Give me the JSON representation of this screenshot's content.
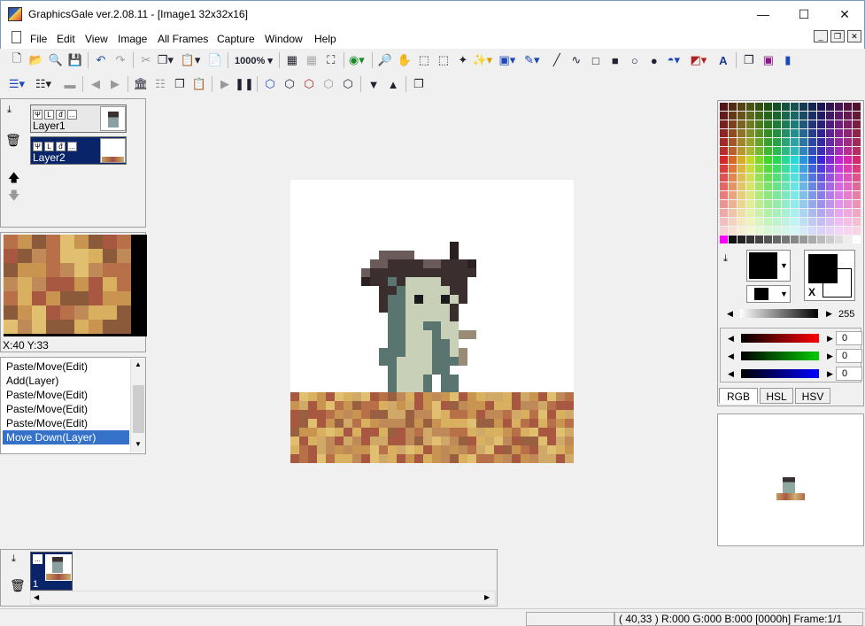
{
  "window": {
    "title": "GraphicsGale ver.2.08.11 - [Image1 32x32x16]",
    "minimize_glyph": "—",
    "maximize_glyph": "☐",
    "close_glyph": "✕"
  },
  "menu": [
    "File",
    "Edit",
    "View",
    "Image",
    "All Frames",
    "Capture",
    "Window",
    "Help"
  ],
  "mdi_controls": [
    "_",
    "❐",
    "✕"
  ],
  "toolbar": {
    "zoom_label": "1000%",
    "icons_row1": [
      "new-icon",
      "open-icon",
      "zoom-find-icon",
      "save-icon",
      "undo-icon",
      "redo-icon",
      "cut-icon",
      "copy-icon",
      "paste-icon",
      "paste-new-icon",
      "grid-icon",
      "pixel-grid-icon",
      "fit-icon",
      "color-replace-icon",
      "magnifier-icon",
      "hand-icon",
      "rect-select-icon",
      "lasso-icon",
      "polygon-select-icon",
      "magic-wand-icon",
      "brush-select-icon",
      "pen-icon",
      "line-icon",
      "curve-icon",
      "rect-outline-icon",
      "rect-fill-icon",
      "ellipse-outline-icon",
      "ellipse-fill-icon",
      "fill-bucket-icon",
      "gradient-icon",
      "text-icon",
      "transparent-icon",
      "frame-icon",
      "dropper-icon"
    ],
    "icons_row2": [
      "layer-menu-icon",
      "frame-menu-icon",
      "lock-icon",
      "prev-frame-icon",
      "next-frame-icon",
      "layer-props-icon",
      "all-frames-icon",
      "copy-frame-icon",
      "paste-frame-icon",
      "play-icon",
      "pause-icon",
      "add-layer-icon",
      "delete-layer-icon",
      "erase-layer-icon",
      "merge-layer-icon",
      "down-icon",
      "up-icon",
      "export-icon"
    ]
  },
  "layers": {
    "items": [
      {
        "name": "Layer1",
        "selected": false
      },
      {
        "name": "Layer2",
        "selected": true
      }
    ],
    "layer_buttons": [
      "Ψ",
      "L",
      "đ",
      "..."
    ]
  },
  "preview_panel": {
    "coords": "X:40 Y:33"
  },
  "history": {
    "items": [
      "Paste/Move(Edit)",
      "Add(Layer)",
      "Paste/Move(Edit)",
      "Paste/Move(Edit)",
      "Paste/Move(Edit)",
      "Move Down(Layer)"
    ],
    "selected_index": 5
  },
  "palette": {
    "tabs": [
      "RGB",
      "HSL",
      "HSV"
    ],
    "active_tab": "RGB",
    "fg_color": "#000000",
    "bg_color": "#ffffff",
    "swap_label": "X",
    "brightness_value": "255",
    "r_value": "0",
    "g_value": "0",
    "b_value": "0"
  },
  "frames": {
    "items": [
      {
        "number": "1"
      }
    ],
    "frame_button": "..."
  },
  "status": {
    "info": "( 40,33 ) R:000 G:000 B:000  [0000h]  Frame:1/1"
  },
  "colors": {
    "selection": "#0a246a",
    "history_selection": "#3571c8",
    "title_border": "#7a9bc0"
  }
}
